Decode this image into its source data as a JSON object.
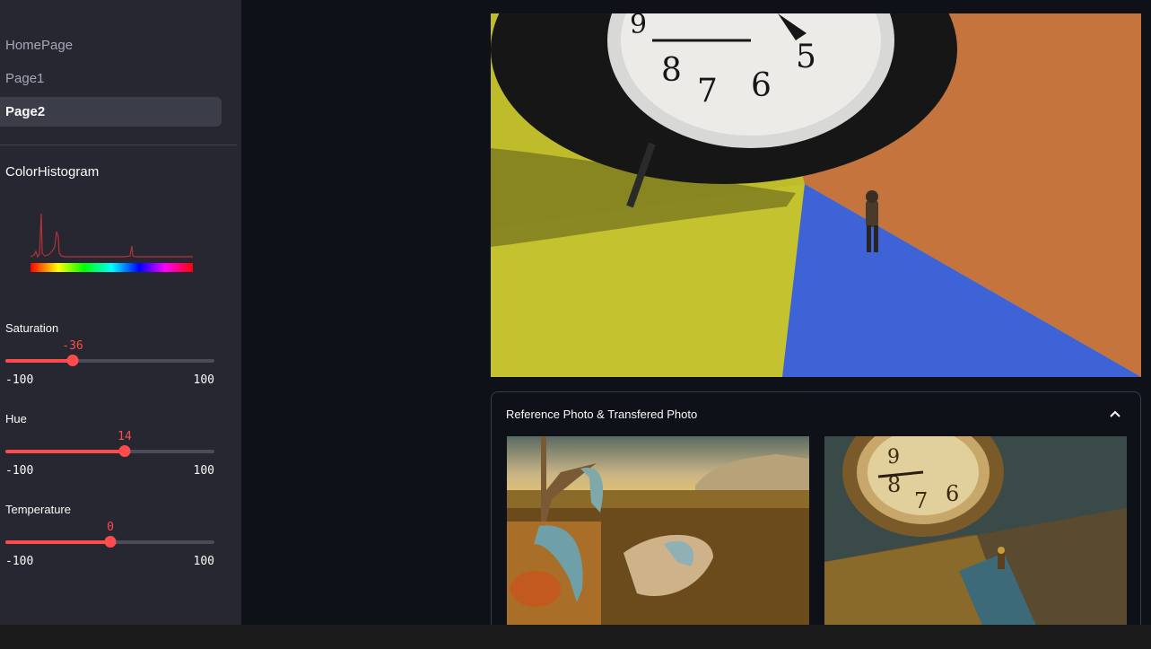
{
  "sidebar": {
    "nav": [
      {
        "label": "HomePage",
        "active": false
      },
      {
        "label": "Page1",
        "active": false
      },
      {
        "label": "Page2",
        "active": true
      }
    ],
    "histogram_title": "ColorHistogram",
    "sliders": [
      {
        "label": "Saturation",
        "value": "-36",
        "min": "-100",
        "max": "100",
        "fraction": 0.32
      },
      {
        "label": "Hue",
        "value": "14",
        "min": "-100",
        "max": "100",
        "fraction": 0.57
      },
      {
        "label": "Temperature",
        "value": "0",
        "min": "-100",
        "max": "100",
        "fraction": 0.5
      }
    ]
  },
  "main": {
    "expander_title": "Reference Photo & Transfered Photo"
  },
  "colors": {
    "accent": "#ff4b4b",
    "background": "#0e1117",
    "sidebar": "#262730"
  }
}
